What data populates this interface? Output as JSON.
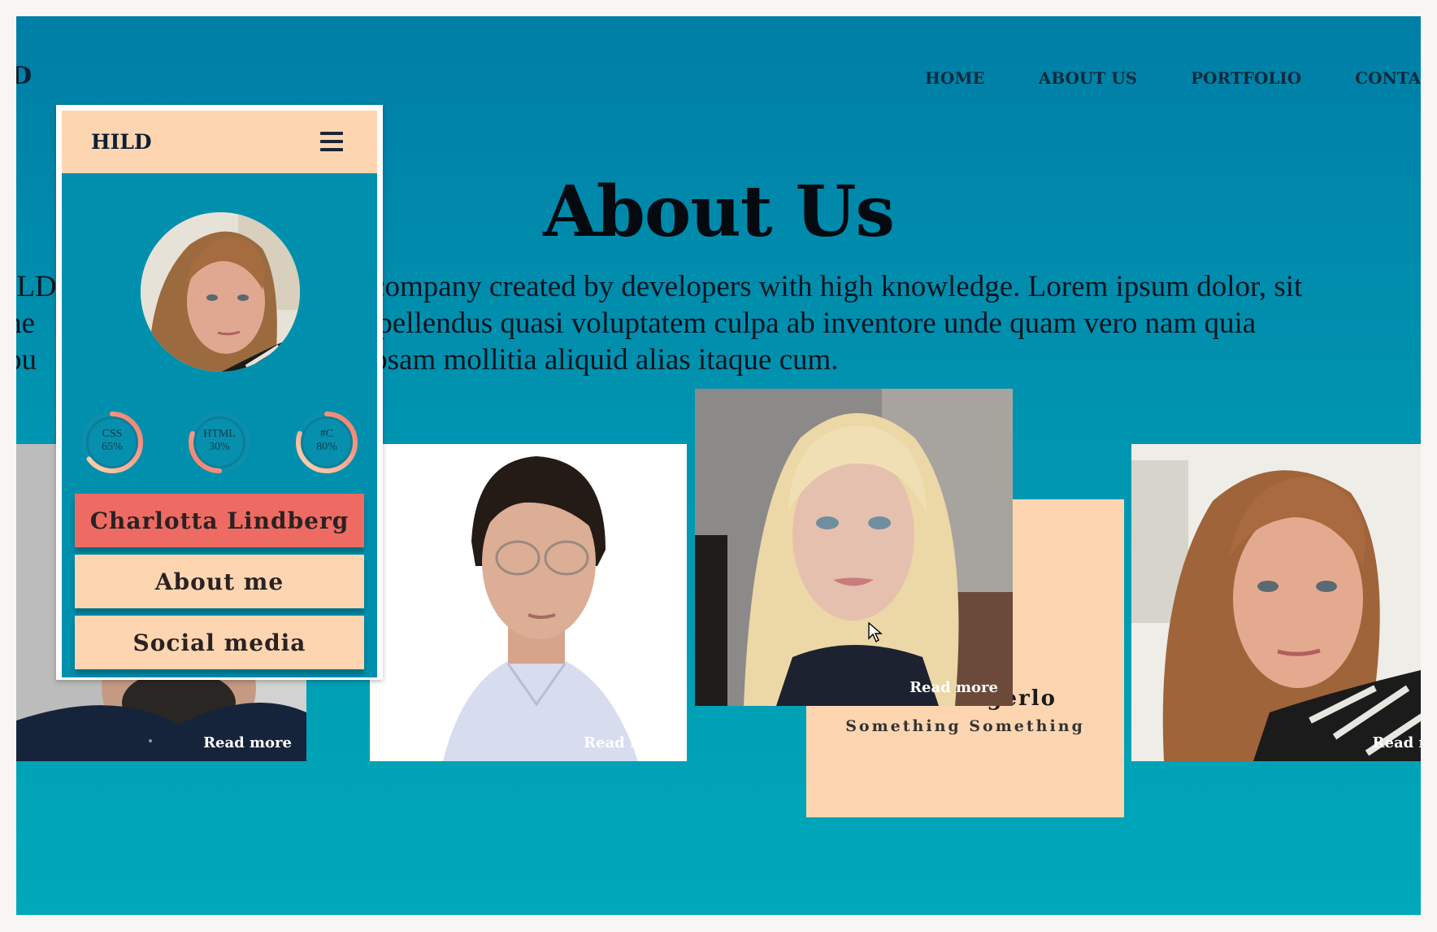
{
  "site": {
    "logo": "ILD",
    "nav": [
      "HOME",
      "ABOUT US",
      "PORTFOLIO",
      "CONTACT U"
    ]
  },
  "about": {
    "title": "About Us",
    "lines": [
      "ILD                                  here company created by developers with high knowledge. Lorem ipsum dolor, sit",
      "he                                  elit. Repellendus quasi voluptatem culpa ab inventore unde quam vero nam quia",
      "pu                                  fugit, ipsam mollitia aliquid alias itaque cum."
    ]
  },
  "cards": [
    {
      "read_more": "Read more"
    },
    {
      "read_more": "Read more"
    },
    {
      "read_more": "Read more",
      "name": "Hanna Agerlo",
      "role": "Something Something"
    },
    {
      "read_more": "Read mor"
    }
  ],
  "phone": {
    "logo": "HILD",
    "skills": [
      {
        "name": "CSS",
        "percent": "65%",
        "value": 0.65
      },
      {
        "name": "HTML",
        "percent": "30%",
        "value": 0.3
      },
      {
        "name": "#C",
        "percent": "80%",
        "value": 0.8
      }
    ],
    "buttons": {
      "name": "Charlotta Lindberg",
      "about": "About me",
      "social": "Social media"
    }
  },
  "colors": {
    "background_top": "#007ea6",
    "background_bottom": "#00a8b9",
    "peach": "#fdd6b1",
    "coral": "#ee6b63",
    "skill_gradient_start": "#fdd6b1",
    "skill_gradient_end": "#f47b6c"
  }
}
